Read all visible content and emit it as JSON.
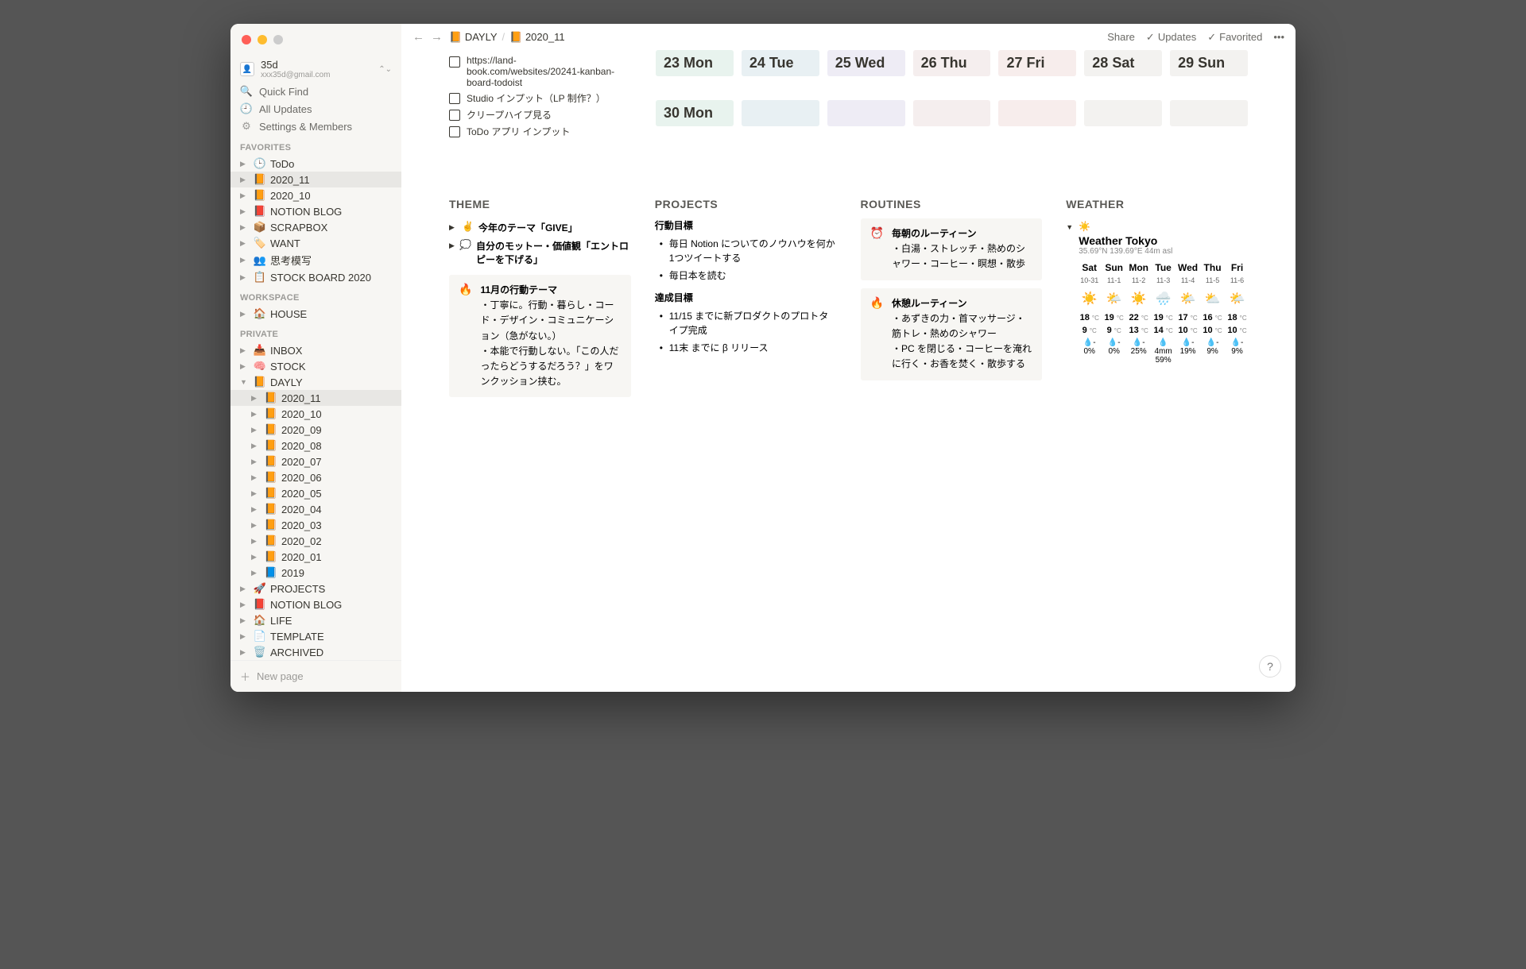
{
  "user": {
    "name": "35d",
    "email": "xxx35d@gmail.com"
  },
  "sb": {
    "quickfind": "Quick Find",
    "updates": "All Updates",
    "settings": "Settings & Members",
    "sections": {
      "fav": "FAVORITES",
      "ws": "WORKSPACE",
      "priv": "PRIVATE"
    },
    "fav": [
      {
        "icon": "🕒",
        "label": "ToDo"
      },
      {
        "icon": "📙",
        "label": "2020_11",
        "active": true
      },
      {
        "icon": "📙",
        "label": "2020_10"
      },
      {
        "icon": "📕",
        "label": "NOTION BLOG"
      },
      {
        "icon": "📦",
        "label": "SCRAPBOX"
      },
      {
        "icon": "🏷️",
        "label": "WANT"
      },
      {
        "icon": "👥",
        "label": "思考模写"
      },
      {
        "icon": "📋",
        "label": "STOCK BOARD 2020"
      }
    ],
    "ws": [
      {
        "icon": "🏠",
        "label": "HOUSE"
      }
    ],
    "priv": [
      {
        "icon": "📥",
        "label": "INBOX",
        "d": 0
      },
      {
        "icon": "🧠",
        "label": "STOCK",
        "d": 0
      },
      {
        "icon": "📙",
        "label": "DAYLY",
        "d": 0,
        "open": true
      },
      {
        "icon": "📙",
        "label": "2020_11",
        "d": 1,
        "active": true
      },
      {
        "icon": "📙",
        "label": "2020_10",
        "d": 1
      },
      {
        "icon": "📙",
        "label": "2020_09",
        "d": 1
      },
      {
        "icon": "📙",
        "label": "2020_08",
        "d": 1
      },
      {
        "icon": "📙",
        "label": "2020_07",
        "d": 1
      },
      {
        "icon": "📙",
        "label": "2020_06",
        "d": 1
      },
      {
        "icon": "📙",
        "label": "2020_05",
        "d": 1
      },
      {
        "icon": "📙",
        "label": "2020_04",
        "d": 1
      },
      {
        "icon": "📙",
        "label": "2020_03",
        "d": 1
      },
      {
        "icon": "📙",
        "label": "2020_02",
        "d": 1
      },
      {
        "icon": "📙",
        "label": "2020_01",
        "d": 1
      },
      {
        "icon": "📘",
        "label": "2019",
        "d": 1
      },
      {
        "icon": "🚀",
        "label": "PROJECTS",
        "d": 0
      },
      {
        "icon": "📕",
        "label": "NOTION BLOG",
        "d": 0
      },
      {
        "icon": "🏠",
        "label": "LIFE",
        "d": 0
      },
      {
        "icon": "📄",
        "label": "TEMPLATE",
        "d": 0
      },
      {
        "icon": "🗑️",
        "label": "ARCHIVED",
        "d": 0
      }
    ],
    "newpage": "New page"
  },
  "topbar": {
    "bc": [
      {
        "icon": "📙",
        "label": "DAYLY"
      },
      {
        "icon": "📙",
        "label": "2020_11"
      }
    ],
    "share": "Share",
    "updates": "Updates",
    "favorited": "Favorited"
  },
  "todos": [
    "https://land-book.com/websites/20241-kanban-board-todoist",
    "Studio インプット（LP 制作？）",
    "クリープハイプ見る",
    "ToDo アプリ インプット"
  ],
  "cal": {
    "row1": [
      {
        "lbl": "23 Mon",
        "c": "c-mon"
      },
      {
        "lbl": "24 Tue",
        "c": "c-tue"
      },
      {
        "lbl": "25 Wed",
        "c": "c-wed"
      },
      {
        "lbl": "26 Thu",
        "c": "c-thu"
      },
      {
        "lbl": "27 Fri",
        "c": "c-fri"
      },
      {
        "lbl": "28 Sat",
        "c": "c-sat"
      },
      {
        "lbl": "29 Sun",
        "c": "c-sun"
      }
    ],
    "row2": [
      {
        "lbl": "30 Mon",
        "c": "c-mon"
      },
      {
        "lbl": "",
        "c": "c-tue"
      },
      {
        "lbl": "",
        "c": "c-wed"
      },
      {
        "lbl": "",
        "c": "c-thu"
      },
      {
        "lbl": "",
        "c": "c-fri"
      },
      {
        "lbl": "",
        "c": "c-sat"
      },
      {
        "lbl": "",
        "c": "c-sun"
      }
    ]
  },
  "theme": {
    "title": "THEME",
    "t1": {
      "icon": "✌️",
      "text": "今年のテーマ「GIVE」"
    },
    "t2": {
      "icon": "💭",
      "text": "自分のモットー・価値観「エントロピーを下げる」"
    },
    "callout": {
      "icon": "🔥",
      "title": "11月の行動テーマ",
      "lines": [
        "・丁寧に。行動・暮らし・コード・デザイン・コミュニケーション（急がない。）",
        "・本能で行動しない。「この人だったらどうするだろう？」をワンクッション挟む。"
      ]
    }
  },
  "projects": {
    "title": "PROJECTS",
    "s1": "行動目標",
    "b1": [
      "毎日 Notion についてのノウハウを何か1つツイートする",
      "毎日本を読む"
    ],
    "s2": "達成目標",
    "b2": [
      "11/15 までに新プロダクトのプロトタイプ完成",
      "11末 までに β リリース"
    ]
  },
  "routines": {
    "title": "ROUTINES",
    "c1": {
      "icon": "⏰",
      "title": "毎朝のルーティーン",
      "text": "・白湯・ストレッチ・熱めのシャワー・コーヒー・瞑想・散歩"
    },
    "c2": {
      "icon": "🔥",
      "title": "休憩ルーティーン",
      "text": "・あずきの力・首マッサージ・筋トレ・熱めのシャワー\n・PC を閉じる・コーヒーを淹れに行く・お香を焚く・散歩する"
    }
  },
  "weather": {
    "title": "WEATHER",
    "ticon": "☀️",
    "loc": "Weather Tokyo",
    "coords": "35.69°N 139.69°E 44m asl",
    "days": [
      {
        "d": "Sat",
        "dt": "10-31",
        "ic": "☀️",
        "hi": "18",
        "lo": "9",
        "p": "0%"
      },
      {
        "d": "Sun",
        "dt": "11-1",
        "ic": "🌤️",
        "hi": "19",
        "lo": "9",
        "p": "0%"
      },
      {
        "d": "Mon",
        "dt": "11-2",
        "ic": "☀️",
        "hi": "22",
        "lo": "13",
        "p": "25%"
      },
      {
        "d": "Tue",
        "dt": "11-3",
        "ic": "🌧️",
        "hi": "19",
        "lo": "14",
        "p": "59%",
        "mm": "4mm"
      },
      {
        "d": "Wed",
        "dt": "11-4",
        "ic": "🌤️",
        "hi": "17",
        "lo": "10",
        "p": "19%"
      },
      {
        "d": "Thu",
        "dt": "11-5",
        "ic": "⛅",
        "hi": "16",
        "lo": "10",
        "p": "9%"
      },
      {
        "d": "Fri",
        "dt": "11-6",
        "ic": "🌤️",
        "hi": "18",
        "lo": "10",
        "p": "9%"
      }
    ]
  },
  "help": "?"
}
